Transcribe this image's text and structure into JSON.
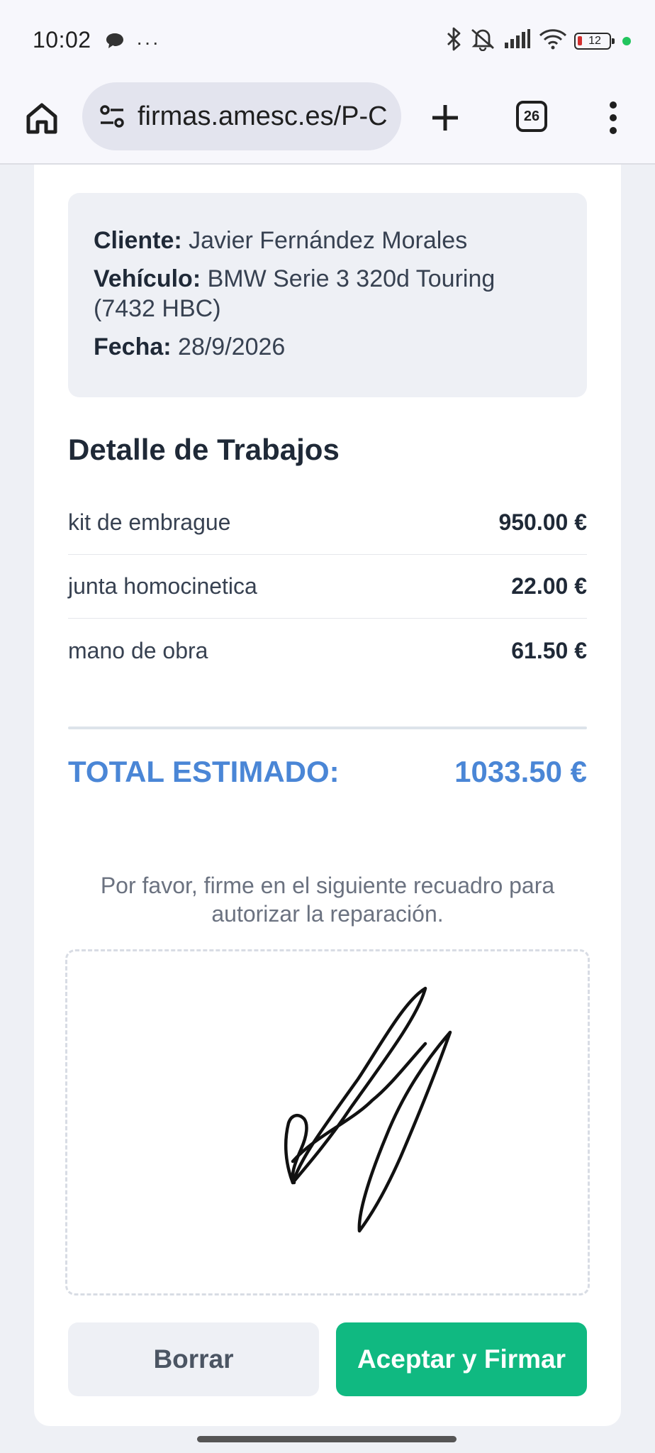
{
  "status_bar": {
    "time": "10:02",
    "more": "···",
    "battery": "12"
  },
  "browser": {
    "url": "firmas.amesc.es/P-C",
    "tab_count": "26"
  },
  "quote": {
    "client_label": "Cliente:",
    "client_value": "Javier Fernández Morales",
    "vehicle_label": "Vehículo:",
    "vehicle_value": "BMW Serie 3 320d Touring (7432 HBC)",
    "date_label": "Fecha:",
    "date_value": "28/9/2026"
  },
  "work": {
    "title": "Detalle de Trabajos",
    "items": [
      {
        "desc": "kit de embrague",
        "price": "950.00 €"
      },
      {
        "desc": "junta homocinetica",
        "price": "22.00 €"
      },
      {
        "desc": "mano de obra",
        "price": "61.50 €"
      }
    ],
    "total_label": "TOTAL ESTIMADO:",
    "total_value": "1033.50 €"
  },
  "signature": {
    "instruction": "Por favor, firme en el siguiente recuadro para autorizar la reparación."
  },
  "actions": {
    "clear_label": "Borrar",
    "accept_label": "Aceptar y Firmar"
  },
  "colors": {
    "accent_blue": "#4a86d6",
    "accept_green": "#10b981"
  }
}
